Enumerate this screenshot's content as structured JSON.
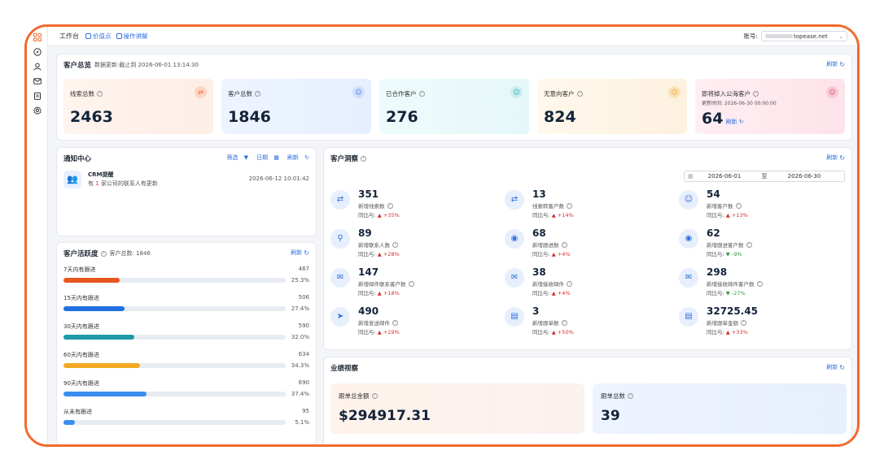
{
  "topbar": {
    "crumb": "工作台",
    "link1": "价值点",
    "link2": "操作讲解",
    "account_label": "账号:",
    "account_value": "topease.net"
  },
  "overview": {
    "title": "客户总览",
    "subtitle": "数据更新:截止到 2026-06-01 13:14:30",
    "refresh": "刷新",
    "cards": [
      {
        "label": "线索总数",
        "value": "2463",
        "icon": "swap-icon",
        "color": "#f26a2e"
      },
      {
        "label": "客户总数",
        "value": "1846",
        "icon": "user-icon",
        "color": "#3d7be6"
      },
      {
        "label": "已合作客户",
        "value": "276",
        "icon": "user-icon",
        "color": "#27a8b8"
      },
      {
        "label": "无意向客户",
        "value": "824",
        "icon": "user-icon",
        "color": "#f0a020"
      },
      {
        "label": "即将掉入公海客户",
        "value": "64",
        "icon": "user-icon",
        "color": "#e0446a",
        "note": "更新时间: 2026-06-30 00:00:00",
        "refresh": "刷新"
      }
    ]
  },
  "notice": {
    "title": "通知中心",
    "filter": "筛选",
    "date": "日期",
    "refresh": "刷新",
    "item_title": "CRM提醒",
    "item_pre": "有",
    "item_count": "1",
    "item_post": "家公司的联系人有更新",
    "item_time": "2026-06-12 10:01:42"
  },
  "activity": {
    "title": "客户活跃度",
    "subtitle": "客户总数: 1846",
    "refresh": "刷新",
    "rows": [
      {
        "label": "7天内有跟进",
        "count": "467",
        "pct": "25.3%",
        "fraction": 0.253,
        "color": "#e8551f"
      },
      {
        "label": "15天内有跟进",
        "count": "506",
        "pct": "27.4%",
        "fraction": 0.274,
        "color": "#1f6fe0"
      },
      {
        "label": "30天内有跟进",
        "count": "590",
        "pct": "32.0%",
        "fraction": 0.32,
        "color": "#1f9aa8"
      },
      {
        "label": "60天内有跟进",
        "count": "634",
        "pct": "34.3%",
        "fraction": 0.343,
        "color": "#f2aa24"
      },
      {
        "label": "90天内有跟进",
        "count": "690",
        "pct": "37.4%",
        "fraction": 0.374,
        "color": "#3a8ef0"
      },
      {
        "label": "从未有跟进",
        "count": "95",
        "pct": "5.1%",
        "fraction": 0.051,
        "color": "#3a8ef0"
      }
    ]
  },
  "insight": {
    "title": "客户洞察",
    "refresh": "刷新",
    "date_start": "2026-06-01",
    "date_to": "至",
    "date_end": "2026-06-30",
    "yoy_label": "同比与:",
    "metrics": [
      {
        "value": "351",
        "label": "新增线索数",
        "yoy": "+35%",
        "dir": "up",
        "icon": "swap-icon"
      },
      {
        "value": "13",
        "label": "线索转客户数",
        "yoy": "+14%",
        "dir": "up",
        "icon": "swap-icon"
      },
      {
        "value": "54",
        "label": "新增客户数",
        "yoy": "+13%",
        "dir": "up",
        "icon": "user-icon"
      },
      {
        "value": "89",
        "label": "新增联系人数",
        "yoy": "+28%",
        "dir": "up",
        "icon": "user-search-icon"
      },
      {
        "value": "68",
        "label": "新增跟进数",
        "yoy": "+4%",
        "dir": "up",
        "icon": "user-circle-icon"
      },
      {
        "value": "62",
        "label": "新增跟进客户数",
        "yoy": "-9%",
        "dir": "down",
        "icon": "user-circle-icon"
      },
      {
        "value": "147",
        "label": "新增邮件联系客户数",
        "yoy": "+18%",
        "dir": "up",
        "icon": "mail-icon"
      },
      {
        "value": "38",
        "label": "新增接收邮件",
        "yoy": "+4%",
        "dir": "up",
        "icon": "mail-icon"
      },
      {
        "value": "298",
        "label": "新增接收邮件客户数",
        "yoy": "-27%",
        "dir": "down",
        "icon": "mail-icon"
      },
      {
        "value": "490",
        "label": "新增发送邮件",
        "yoy": "+29%",
        "dir": "up",
        "icon": "send-icon"
      },
      {
        "value": "3",
        "label": "新增跟单数",
        "yoy": "+50%",
        "dir": "up",
        "icon": "clipboard-icon"
      },
      {
        "value": "32725.45",
        "label": "新增跟单金额",
        "yoy": "+33%",
        "dir": "up",
        "icon": "clipboard-icon"
      }
    ]
  },
  "performance": {
    "title": "业绩视察",
    "refresh": "刷新",
    "total_amount_label": "跟单总金额",
    "total_amount_value": "$294917.31",
    "total_count_label": "跟单总数",
    "total_count_value": "39"
  }
}
